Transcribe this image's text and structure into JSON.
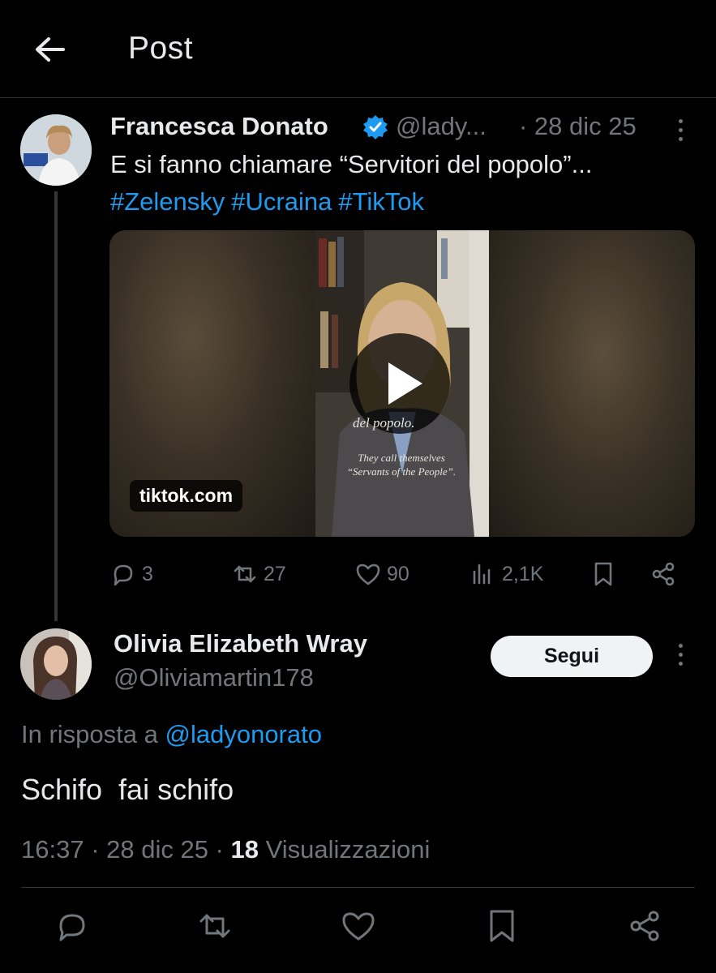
{
  "header": {
    "title": "Post"
  },
  "quoted_post": {
    "author": "Francesca Donato",
    "handle": "@lady...",
    "date": "· 28 dic 25",
    "text": "E si fanno chiamare “Servitori del popolo”...",
    "hashtags": [
      "#Zelensky",
      "#Ucraina",
      "#TikTok"
    ],
    "media": {
      "source": "tiktok.com",
      "caption_overlay": "del popolo.",
      "subtitle_overlay": "They call themselves “Servants of the People”."
    },
    "stats": {
      "replies": "3",
      "reposts": "27",
      "likes": "90",
      "views": "2,1K"
    }
  },
  "reply": {
    "author": "Olivia Elizabeth Wray",
    "handle": "@Oliviamartin178",
    "follow_label": "Segui",
    "reply_to_prefix": "In risposta a",
    "reply_to_handle": "@ladyonorato",
    "text": "Schifo  fai schifo",
    "time": "16:37 · 28 dic 25 · ",
    "views_count": "18",
    "views_label": " Visualizzazioni"
  },
  "colors": {
    "accent": "#1d9bf0",
    "muted": "#71767b",
    "text": "#e7e9ea",
    "background": "#000000"
  }
}
